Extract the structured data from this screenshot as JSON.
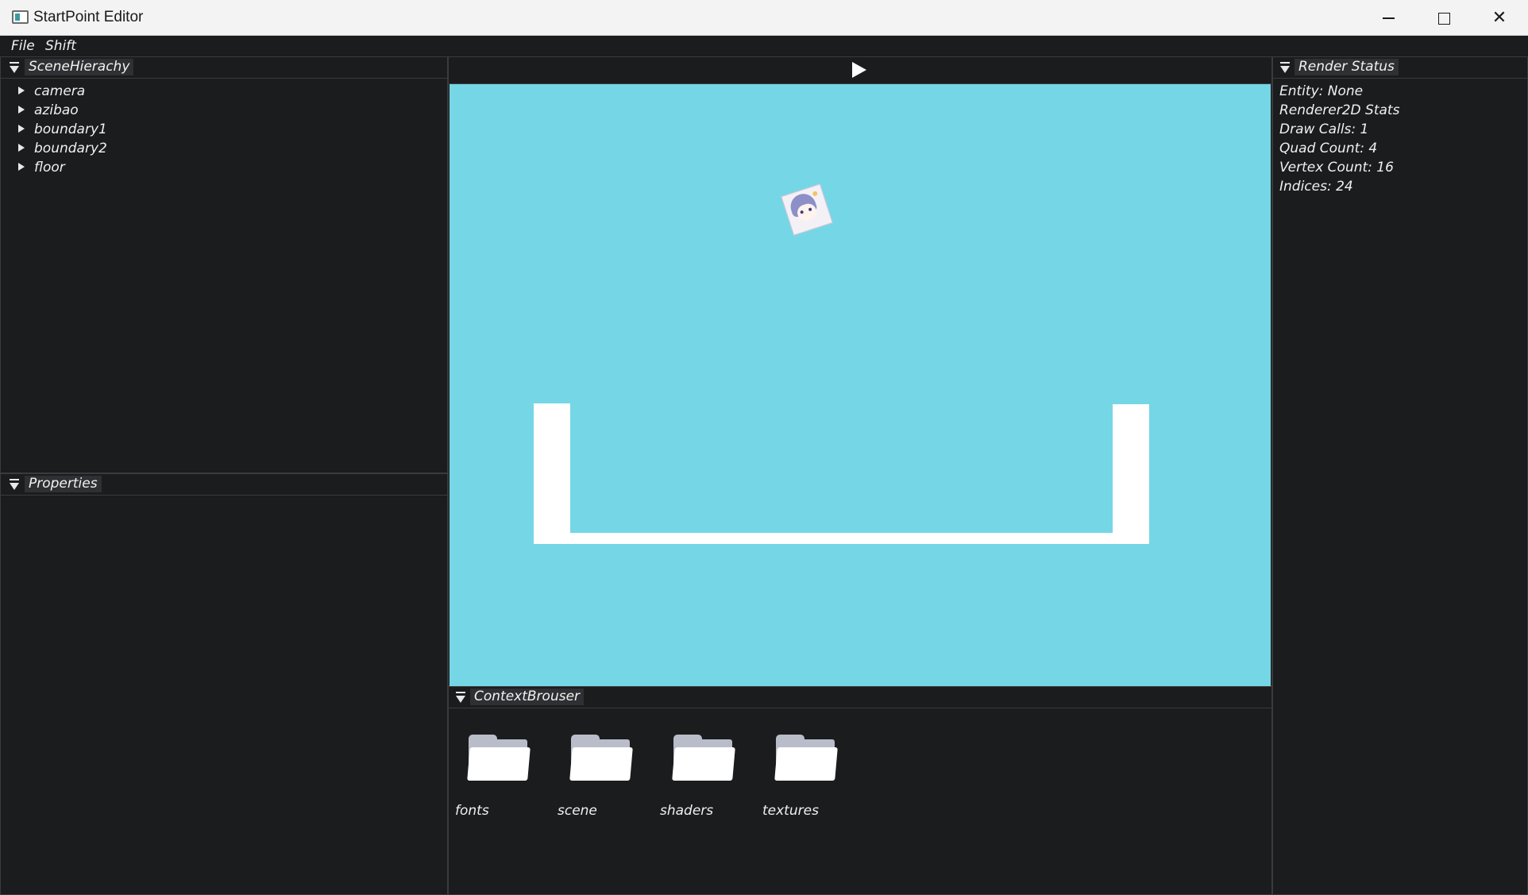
{
  "window": {
    "title": "StartPoint Editor"
  },
  "menu": {
    "items": [
      "File",
      "Shift"
    ]
  },
  "scene_hierarchy": {
    "title": "SceneHierachy",
    "entities": [
      "camera",
      "azibao",
      "boundary1",
      "boundary2",
      "floor"
    ]
  },
  "properties": {
    "title": "Properties"
  },
  "viewport": {
    "background_color": "#75d6e6",
    "play_icon": "play-icon"
  },
  "context_browser": {
    "title": "ContextBrouser",
    "folders": [
      "fonts",
      "scene",
      "shaders",
      "textures"
    ]
  },
  "render_status": {
    "title": "Render Status",
    "lines": [
      "Entity: None",
      "Renderer2D Stats",
      "Draw Calls: 1",
      "Quad Count: 4",
      "Vertex Count: 16",
      "Indices: 24"
    ]
  }
}
